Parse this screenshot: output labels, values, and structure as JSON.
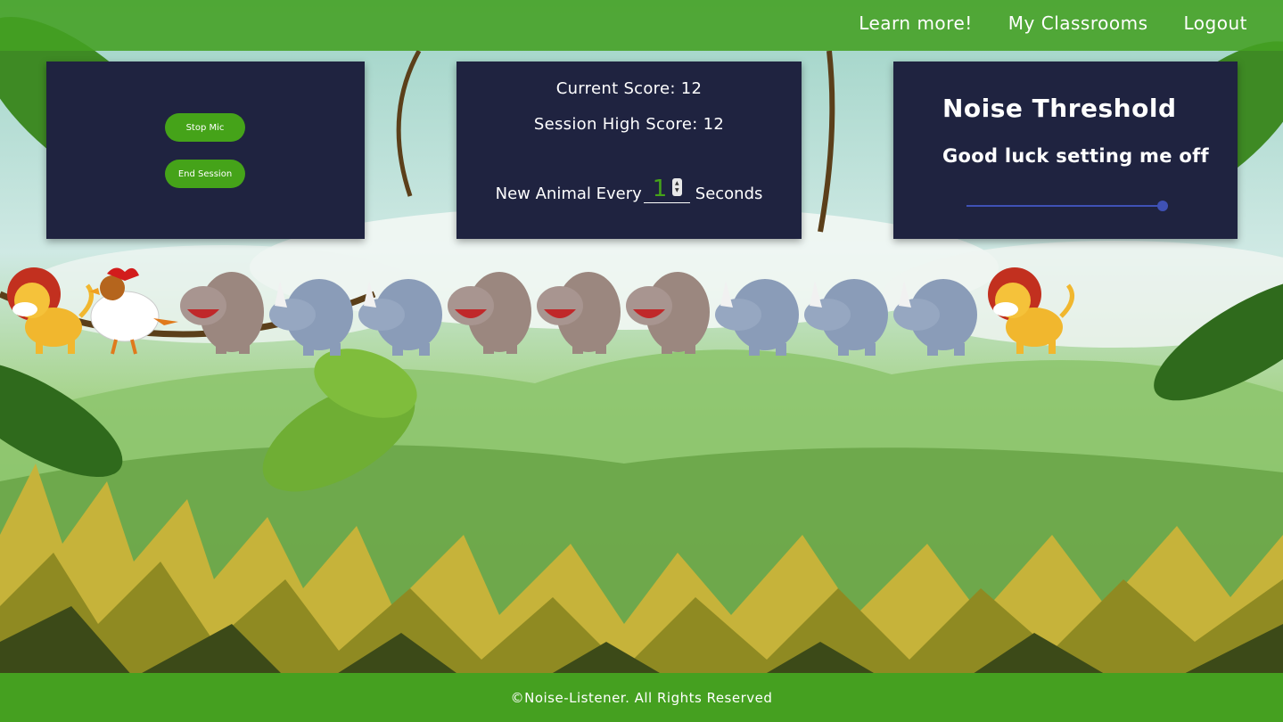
{
  "nav": {
    "learn_more": "Learn more!",
    "classrooms": "My Classrooms",
    "logout": "Logout"
  },
  "controls": {
    "stop_mic": "Stop Mic",
    "end_session": "End Session"
  },
  "score": {
    "current": "Current Score: 12",
    "high": "Session High Score: 12",
    "every_label": "New Animal Every",
    "every_value": "1",
    "seconds_label": "Seconds"
  },
  "threshold": {
    "title": "Noise Threshold",
    "subtitle": "Good luck setting me off",
    "slider_level_fraction": 0.97
  },
  "animals": [
    "lion",
    "rooster",
    "hippo",
    "rhino",
    "rhino",
    "hippo",
    "hippo",
    "hippo",
    "rhino",
    "rhino",
    "rhino",
    "lion"
  ],
  "footer": {
    "copyright": "©Noise-Listener. All Rights Reserved"
  },
  "colors": {
    "topbar": "#44a022",
    "panel": "#1f2340",
    "button": "#45a319",
    "slider": "#3f51b5"
  }
}
